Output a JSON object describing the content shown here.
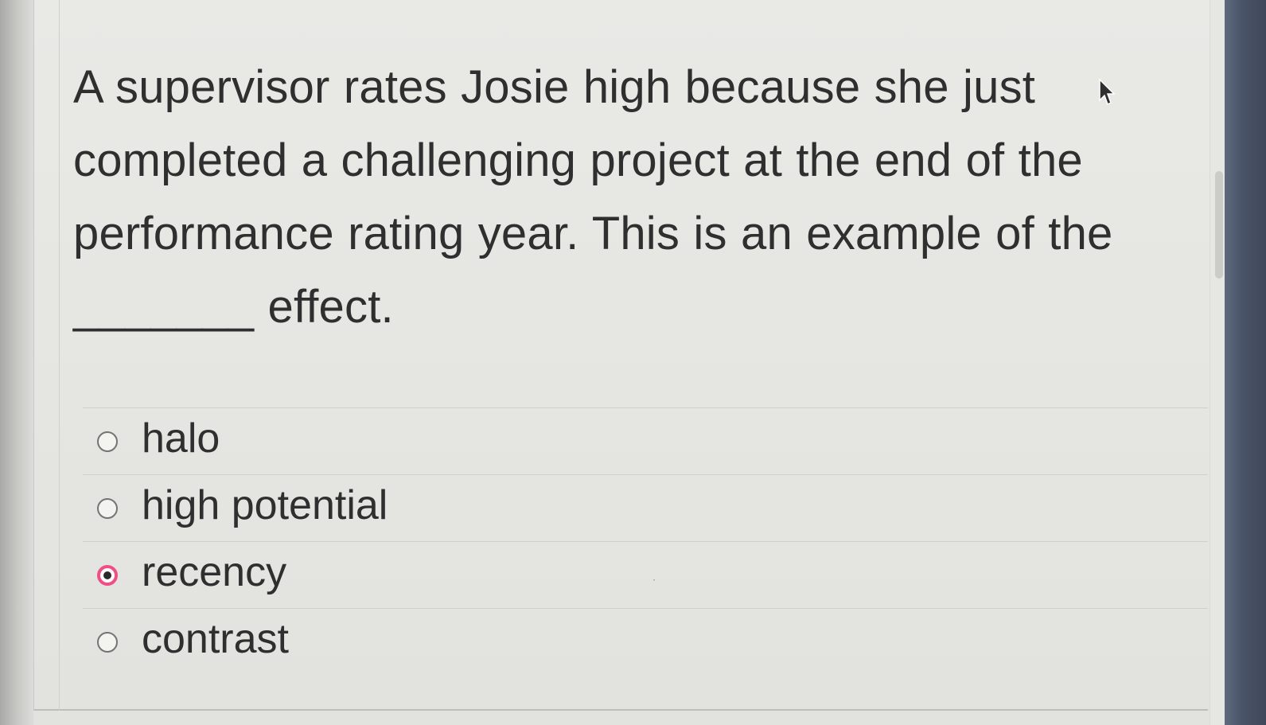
{
  "question": {
    "text": "A supervisor rates Josie high because she just completed a challenging project at the end of the performance rating year. This is an example of the _______ effect."
  },
  "options": [
    {
      "label": "halo",
      "selected": false
    },
    {
      "label": "high potential",
      "selected": false
    },
    {
      "label": "recency",
      "selected": true
    },
    {
      "label": "contrast",
      "selected": false
    }
  ],
  "colors": {
    "selected_radio": "#ee4f84",
    "text": "#2f2f2f"
  },
  "icons": {
    "cursor": "mouse-pointer-icon"
  }
}
